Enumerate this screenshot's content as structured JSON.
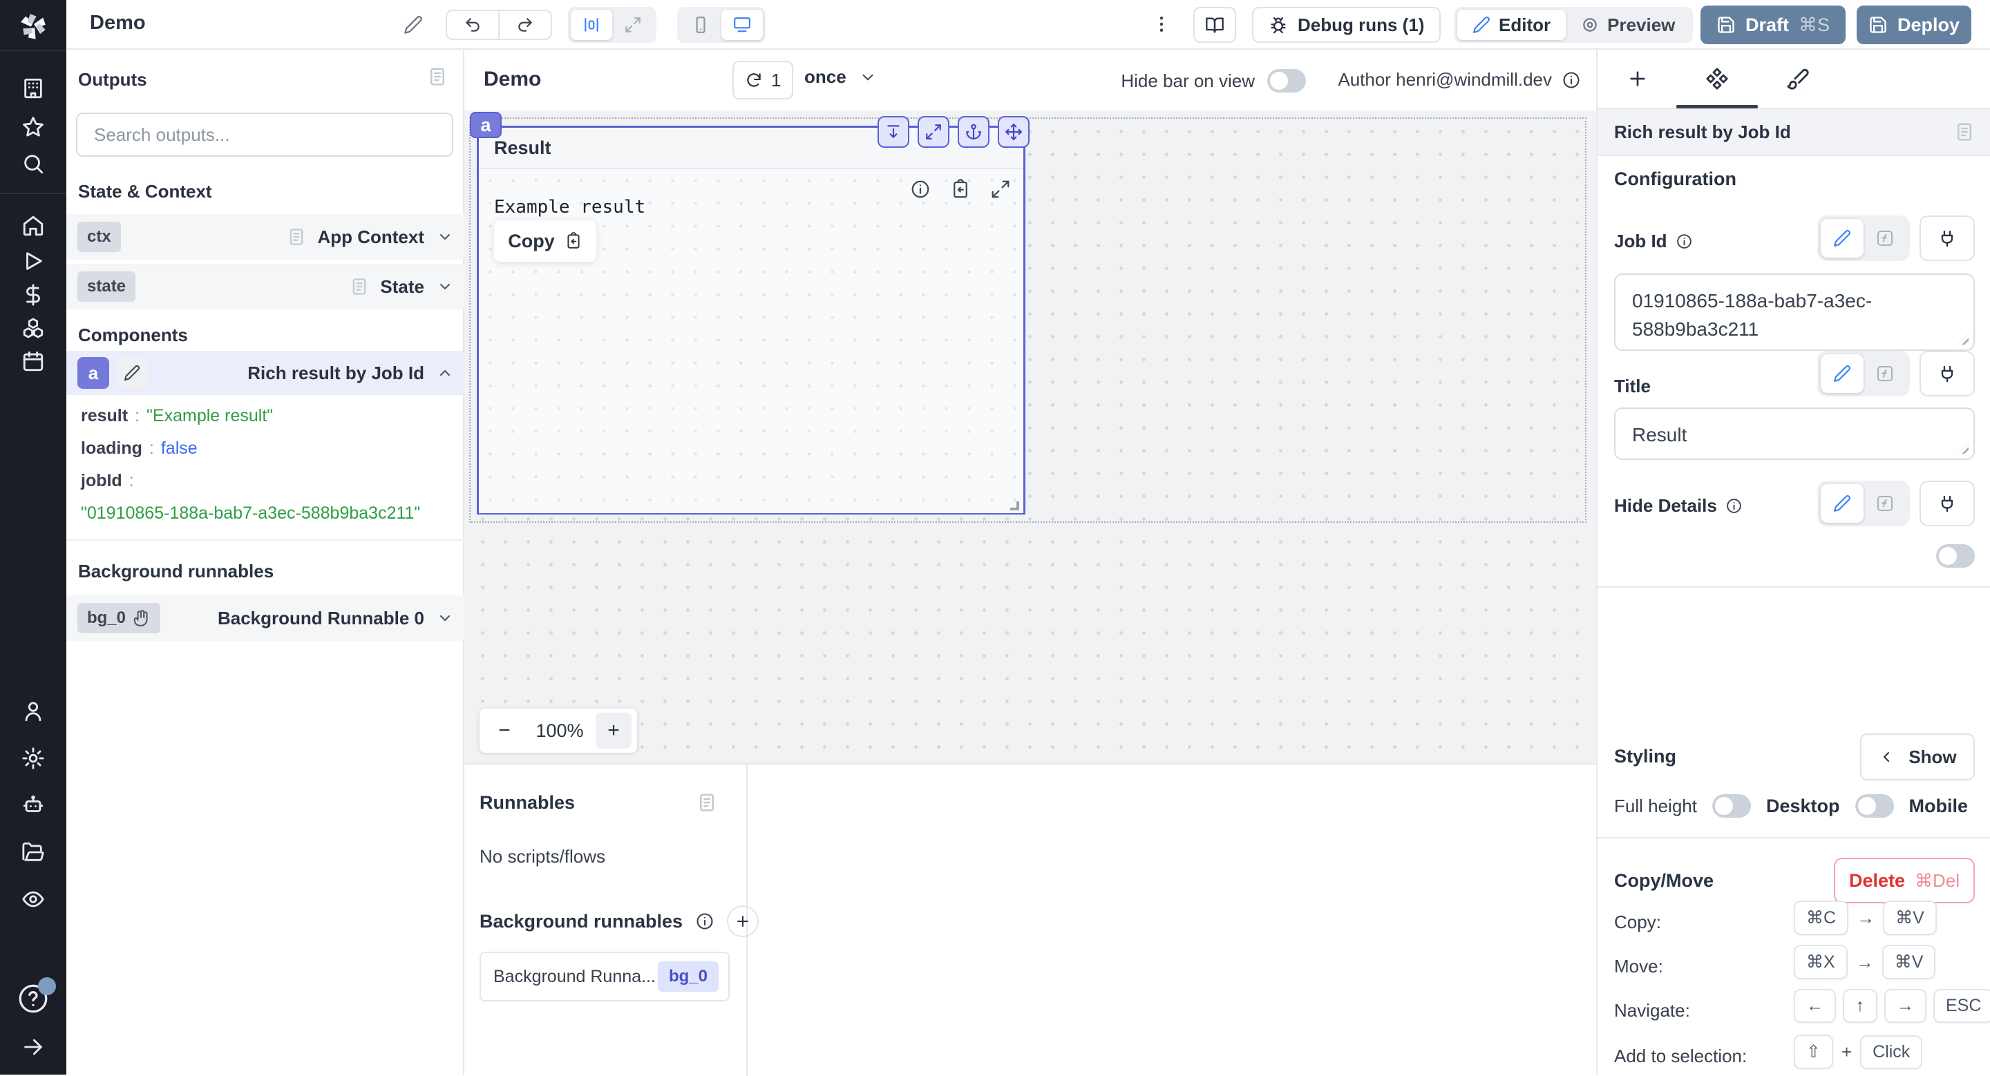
{
  "topbar": {
    "app_title": "Demo",
    "debug_runs": "Debug runs (1)",
    "editor": "Editor",
    "preview": "Preview",
    "draft": "Draft",
    "draft_shortcut": "⌘S",
    "deploy": "Deploy"
  },
  "outputs": {
    "title": "Outputs",
    "search_placeholder": "Search outputs...",
    "state_heading": "State & Context",
    "ctx_badge": "ctx",
    "ctx_label": "App Context",
    "state_badge": "state",
    "state_label": "State",
    "components_heading": "Components",
    "component_badge": "a",
    "component_label": "Rich result by Job Id",
    "json": {
      "colon": ":",
      "k1": "result",
      "v1": "\"Example result\"",
      "k2": "loading",
      "v2": "false",
      "k3": "jobId",
      "v3": "\"01910865-188a-bab7-a3ec-588b9ba3c211\""
    },
    "bg_heading": "Background runnables",
    "bg_badge": "bg_0",
    "bg_label": "Background Runnable 0"
  },
  "canvas": {
    "title": "Demo",
    "refresh_count": "1",
    "schedule": "once",
    "hide_bar": "Hide bar on view",
    "author": "Author henri@windmill.dev",
    "zoom_minus": "−",
    "zoom_value": "100%",
    "zoom_plus": "+",
    "component": {
      "tag": "a",
      "title": "Result",
      "result": "Example result",
      "copy": "Copy"
    }
  },
  "runnables": {
    "title": "Runnables",
    "empty": "No scripts/flows",
    "bg_heading": "Background runnables",
    "item_label": "Background Runna...",
    "item_badge": "bg_0"
  },
  "settings": {
    "header": "Rich result by Job Id",
    "configuration": "Configuration",
    "job_id_label": "Job Id",
    "job_id_value": "01910865-188a-bab7-a3ec-588b9ba3c211",
    "title_label": "Title",
    "title_value": "Result",
    "hide_details_label": "Hide Details",
    "styling": "Styling",
    "show": "Show",
    "full_height": "Full height",
    "desktop": "Desktop",
    "mobile": "Mobile",
    "copy_move": "Copy/Move",
    "delete": "Delete",
    "delete_shortcut": "⌘Del",
    "arrow": "→",
    "plus": "+",
    "shortcuts": [
      {
        "label": "Copy:",
        "k1": "⌘C",
        "k2": "⌘V"
      },
      {
        "label": "Move:",
        "k1": "⌘X",
        "k2": "⌘V"
      },
      {
        "label": "Navigate:",
        "k1": "←",
        "k2": "↑",
        "k3": "→",
        "k4": "ESC"
      },
      {
        "label": "Add to selection:",
        "k1": "⇧",
        "k2": "Click"
      }
    ]
  }
}
